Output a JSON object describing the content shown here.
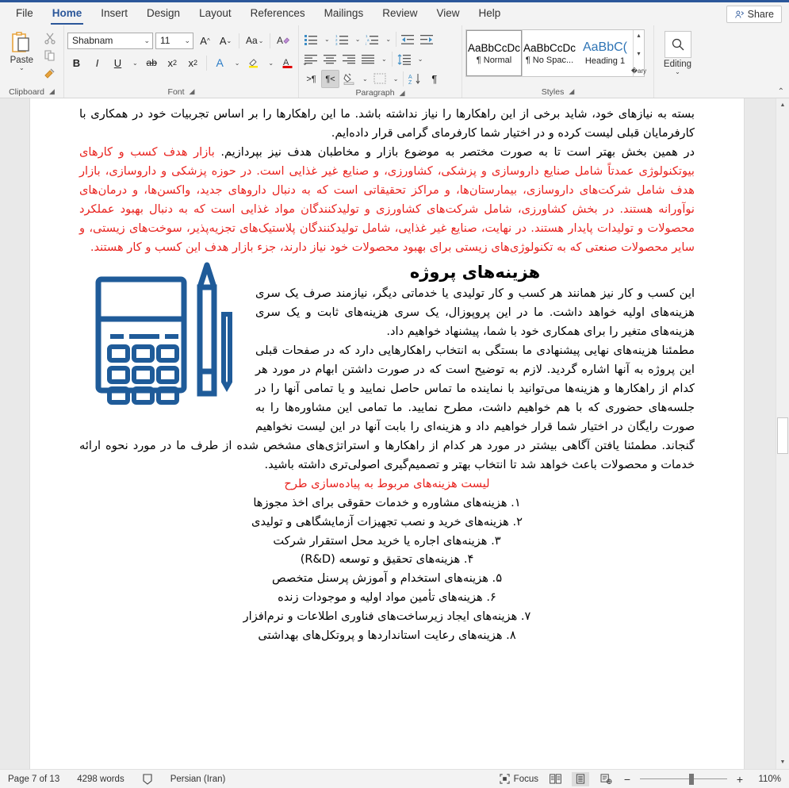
{
  "window": {
    "title": "Microsoft Word"
  },
  "tabs": [
    {
      "label": "File"
    },
    {
      "label": "Home"
    },
    {
      "label": "Insert"
    },
    {
      "label": "Design"
    },
    {
      "label": "Layout"
    },
    {
      "label": "References"
    },
    {
      "label": "Mailings"
    },
    {
      "label": "Review"
    },
    {
      "label": "View"
    },
    {
      "label": "Help"
    }
  ],
  "share": {
    "label": "Share",
    "icon": "share-person-icon"
  },
  "ribbon": {
    "clipboard": {
      "label": "Clipboard",
      "paste_label": "Paste",
      "cut_icon": "scissors-icon",
      "copy_icon": "copy-icon",
      "format_painter_icon": "paintbrush-icon",
      "launcher_icon": "dialog-launcher-icon"
    },
    "font": {
      "label": "Font",
      "font_name": "Shabnam",
      "font_size": "11",
      "grow_icon": "increase-font-size-icon",
      "shrink_icon": "decrease-font-size-icon",
      "change_case_icon": "change-case-icon",
      "clear_formatting_icon": "clear-formatting-icon",
      "bold": "B",
      "italic": "I",
      "underline": "U",
      "strikethrough_icon": "strikethrough-icon",
      "subscript_icon": "subscript-icon",
      "superscript_icon": "superscript-icon",
      "text_effects_icon": "text-effects-icon",
      "highlight_icon": "text-highlight-icon",
      "font_color_icon": "font-color-icon",
      "launcher_icon": "dialog-launcher-icon"
    },
    "paragraph": {
      "label": "Paragraph",
      "bullets_icon": "bullets-icon",
      "numbering_icon": "numbering-icon",
      "multilevel_icon": "multilevel-list-icon",
      "decrease_indent_icon": "decrease-indent-icon",
      "increase_indent_icon": "increase-indent-icon",
      "align_left_icon": "align-left-icon",
      "align_center_icon": "align-center-icon",
      "align_right_icon": "align-right-icon",
      "justify_icon": "justify-icon",
      "line_spacing_icon": "line-spacing-icon",
      "ltr_icon": "left-to-right-text-direction-icon",
      "rtl_icon": "right-to-left-text-direction-icon",
      "shading_icon": "shading-icon",
      "borders_icon": "borders-icon",
      "sort_icon": "sort-icon",
      "show_marks_icon": "show-formatting-marks-icon",
      "launcher_icon": "dialog-launcher-icon"
    },
    "styles": {
      "label": "Styles",
      "items": [
        {
          "preview": "AaBbCcDc",
          "name": "¶ Normal",
          "selected": true
        },
        {
          "preview": "AaBbCcDc",
          "name": "¶ No Spac...",
          "selected": false
        },
        {
          "preview": "AaBbC(",
          "name": "Heading 1",
          "selected": false
        }
      ],
      "launcher_icon": "dialog-launcher-icon"
    },
    "editing": {
      "label": "Editing",
      "icon": "magnifier-icon"
    },
    "collapse_icon": "collapse-ribbon-icon"
  },
  "document": {
    "paragraphs": [
      {
        "color": "black",
        "text": "بسته به نیازهای خود، شاید برخی از این راهکارها را نیاز نداشته باشد. ما این راهکارها را بر اساس تجربیات خود در همکاری با کارفرمایان قبلی لیست کرده و در اختیار شما کارفرمای گرامی قرار داده‌ایم."
      },
      {
        "color": "mixed",
        "black_part": "در همین بخش بهتر است تا به صورت مختصر به موضوع بازار و مخاطبان هدف نیز بپردازیم. ",
        "red_part": "بازار هدف کسب و کارهای بیوتکنولوژی عمدتاً شامل صنایع داروسازی و پزشکی، کشاورزی، و صنایع غیر غذایی است. در حوزه پزشکی و داروسازی، بازار هدف شامل شرکت‌های داروسازی، بیمارستان‌ها، و مراکز تحقیقاتی است که به دنبال داروهای جدید، واکسن‌ها، و درمان‌های نوآورانه هستند. در بخش کشاورزی، شامل شرکت‌های کشاورزی و تولیدکنندگان مواد غذایی است که به دنبال بهبود عملکرد محصولات و تولیدات پایدار هستند. در نهایت، صنایع غیر غذایی، شامل تولیدکنندگان پلاستیک‌های تجزیه‌پذیر، سوخت‌های زیستی، و سایر محصولات صنعتی که به تکنولوژی‌های زیستی برای بهبود محصولات خود نیاز دارند، جزء بازار هدف این کسب و کار هستند."
      }
    ],
    "heading": "هزینه‌های پروژه",
    "image": {
      "name": "calculator-and-pencil-illustration",
      "color": "#1f5b99"
    },
    "body_paragraphs": [
      "این کسب و کار نیز همانند هر کسب و کار تولیدی یا خدماتی دیگر، نیازمند صرف یک سری هزینه‌های اولیه خواهد داشت. ما در این پروپوزال، یک سری هزینه‌های ثابت و یک سری هزینه‌های متغیر را برای همکاری خود با شما، پیشنهاد خواهیم داد.",
      "مطمئنا هزینه‌های نهایی پیشنهادی ما بستگی به انتخاب راهکارهایی دارد که در صفحات قبلی این پروژه به آنها اشاره گردید. لازم به توضیح است که در صورت داشتن ابهام در مورد هر کدام از راهکارها و هزینه‌ها می‌توانید با نماینده ما تماس حاصل نمایید و یا تمامی آنها را در جلسه‌های حضوری که با هم خواهیم داشت، مطرح نمایید. ما تمامی این مشاوره‌ها را به صورت رایگان در اختیار شما قرار خواهیم داد و هزینه‌ای را بابت آنها در این لیست نخواهیم گنجاند. مطمئنا یافتن آگاهی بیشتر در مورد هر کدام از راهکارها و استراتژی‌های مشخص شده از طرف ما در مورد نحوه ارائه خدمات و محصولات باعث خواهد شد تا انتخاب بهتر و تصمیم‌گیری اصولی‌تری داشته باشید."
    ],
    "list_title": "لیست هزینه‌های مربوط به پیاده‌سازی طرح",
    "list_items": [
      "۱. هزینه‌های مشاوره و خدمات حقوقی برای اخذ مجوزها",
      "۲. هزینه‌های خرید و نصب تجهیزات آزمایشگاهی و تولیدی",
      "۳. هزینه‌های اجاره یا خرید محل استقرار شرکت",
      "۴. هزینه‌های تحقیق و توسعه (R&D)",
      "۵. هزینه‌های استخدام و آموزش پرسنل متخصص",
      "۶. هزینه‌های تأمین مواد اولیه و موجودات زنده",
      "۷. هزینه‌های ایجاد زیرساخت‌های فناوری اطلاعات و نرم‌افزار",
      "۸. هزینه‌های رعایت استانداردها و پروتکل‌های بهداشتی"
    ]
  },
  "scrollbar": {
    "up_icon": "scroll-up-arrow-icon",
    "down_icon": "scroll-down-arrow-icon"
  },
  "status": {
    "page": "Page 7 of 13",
    "words": "4298 words",
    "proofing_icon": "proofing-errors-icon",
    "language": "Persian (Iran)",
    "focus_label": "Focus",
    "focus_icon": "focus-mode-icon",
    "read_mode_icon": "read-mode-icon",
    "print_layout_icon": "print-layout-icon",
    "web_layout_icon": "web-layout-icon",
    "zoom_out": "−",
    "zoom_in": "+",
    "zoom_value": "110%"
  }
}
